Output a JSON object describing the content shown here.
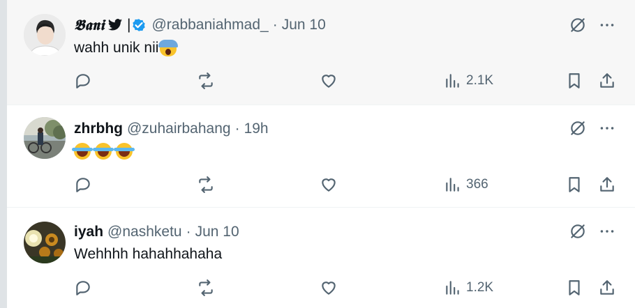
{
  "tweets": [
    {
      "name": "𝕭𝖆𝖓𝖎",
      "name_suffix": "| ",
      "handle": "@rabbaniahmad_",
      "separator": "·",
      "date": "Jun 10",
      "text": "wahh unik nii",
      "emoji": "scream-emoji",
      "verified": true,
      "views": "2.1K"
    },
    {
      "name": "zhrbhg",
      "handle": "@zuhairbahang",
      "separator": "·",
      "date": "19h",
      "emoji": "laugh-emoji x3",
      "views": "366"
    },
    {
      "name": "iyah",
      "handle": "@nashketu",
      "separator": "·",
      "date": "Jun 10",
      "text": "Wehhhh hahahhahaha",
      "views": "1.2K"
    }
  ],
  "colors": {
    "muted": "#536471",
    "verified": "#1d9bf0",
    "hover_bg": "#f7f7f7"
  }
}
